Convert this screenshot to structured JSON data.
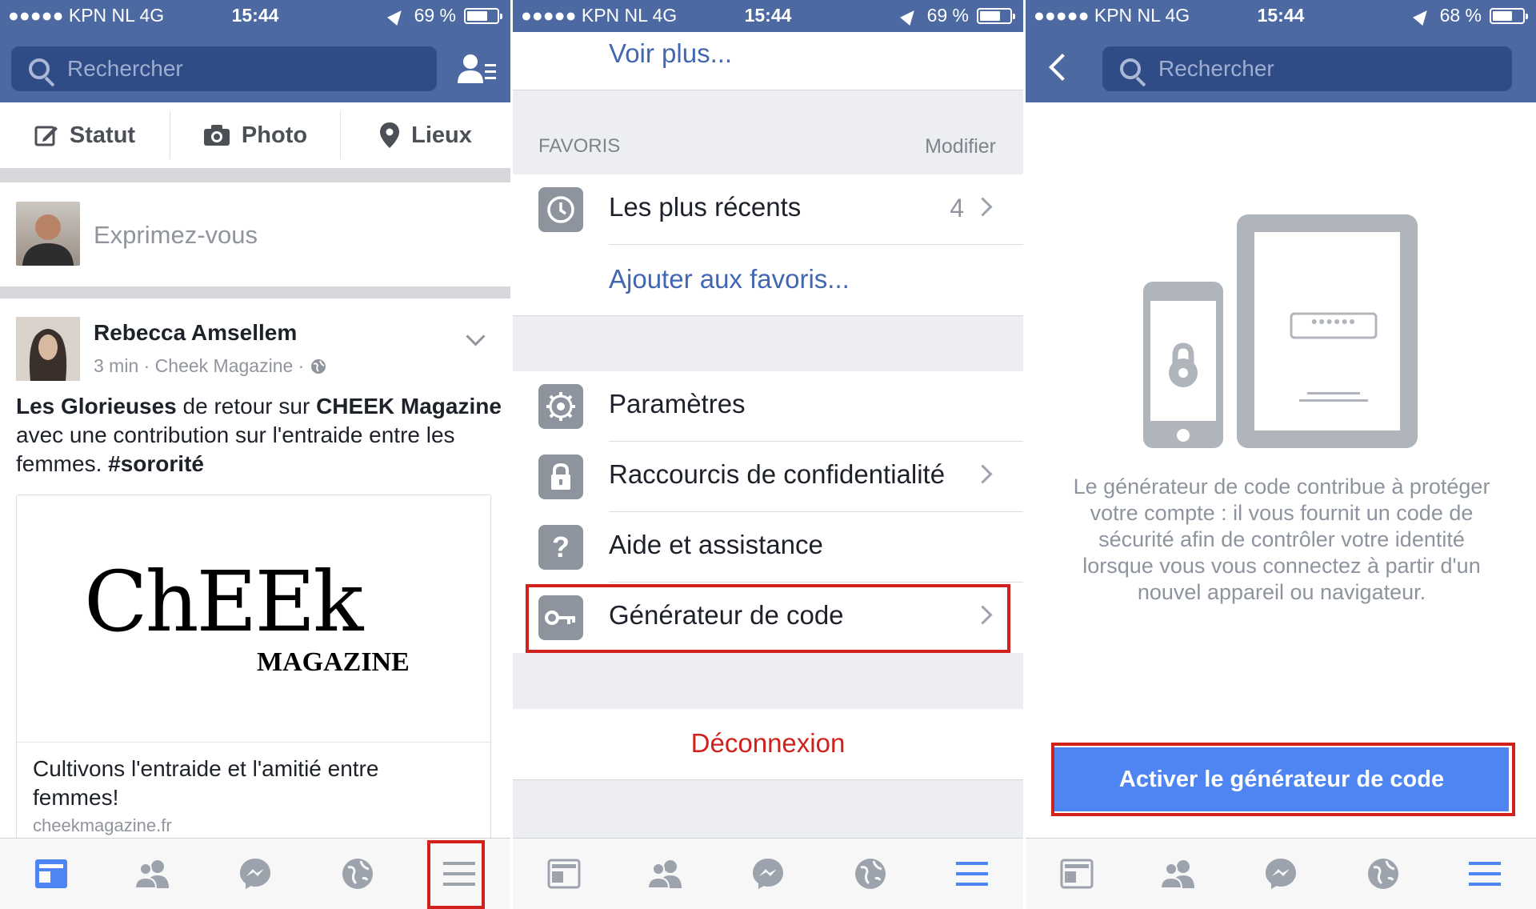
{
  "status_bar": [
    {
      "carrier": "●●●●● KPN NL   4G",
      "time": "15:44",
      "battery": "69 %",
      "battery_level": 0.69
    },
    {
      "carrier": "●●●●● KPN NL   4G",
      "time": "15:44",
      "battery": "69 %",
      "battery_level": 0.69
    },
    {
      "carrier": "●●●●● KPN NL   4G",
      "time": "15:44",
      "battery": "68 %",
      "battery_level": 0.68
    }
  ],
  "search": {
    "placeholder": "Rechercher"
  },
  "feed": {
    "actions": [
      "Statut",
      "Photo",
      "Lieux"
    ],
    "composer_placeholder": "Exprimez-vous",
    "post": {
      "author": "Rebecca Amsellem",
      "meta": "3 min · Cheek Magazine ·",
      "text_parts": [
        "Les Glorieuses",
        " de retour sur ",
        "CHEEK Magazine",
        " avec une contribution sur l'entraide entre les femmes. ",
        "#sororité"
      ],
      "logo_main": "ChEEk",
      "logo_sub": "MAGAZINE",
      "link_title": "Cultivons l'entraide et l'amitié entre femmes!",
      "link_domain": "cheekmagazine.fr"
    }
  },
  "menu": {
    "see_more": "Voir plus...",
    "favorites_header": "FAVORIS",
    "edit_label": "Modifier",
    "recent": {
      "label": "Les plus récents",
      "count": "4"
    },
    "add_favorites": "Ajouter aux favoris...",
    "items": [
      {
        "label": "Paramètres",
        "icon": "gear-icon"
      },
      {
        "label": "Raccourcis de confidentialité",
        "icon": "lock-icon"
      },
      {
        "label": "Aide et assistance",
        "icon": "help-icon"
      },
      {
        "label": "Générateur de code",
        "icon": "key-icon"
      }
    ],
    "logout": "Déconnexion"
  },
  "code_generator": {
    "password_dots": "●●●●●●",
    "description": "Le générateur de code contribue à protéger votre compte : il vous fournit un code de sécurité afin de contrôler votre identité lorsque vous vous connectez à partir d'un nouvel appareil ou navigateur.",
    "button_label": "Activer le générateur de code"
  },
  "tabs": [
    "news-feed-icon",
    "friends-icon",
    "messenger-icon",
    "globe-icon",
    "menu-icon"
  ],
  "colors": {
    "brand": "#4d69a2",
    "link": "#4267b2",
    "logout": "#d0211c",
    "button": "#4f85f2",
    "highlight": "#d0211c"
  }
}
